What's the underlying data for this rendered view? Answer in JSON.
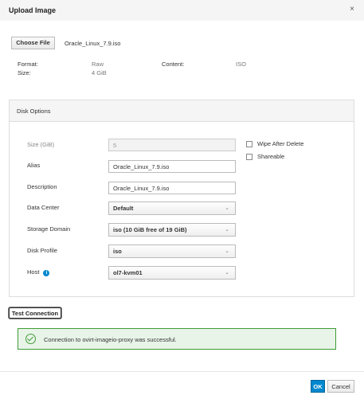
{
  "dialog": {
    "title": "Upload Image",
    "close_glyph": "×"
  },
  "file": {
    "choose_label": "Choose File",
    "name": "Oracle_Linux_7.9.iso"
  },
  "meta": {
    "format_label": "Format:",
    "format_value": "Raw",
    "content_label": "Content:",
    "content_value": "ISO",
    "size_label": "Size:",
    "size_value": "4 GiB"
  },
  "disk_options": {
    "title": "Disk Options",
    "size_label": "Size (GiB)",
    "size_value": "5",
    "alias_label": "Alias",
    "alias_value": "Oracle_Linux_7.9.iso",
    "description_label": "Description",
    "description_value": "Oracle_Linux_7.9.iso",
    "data_center_label": "Data Center",
    "data_center_value": "Default",
    "storage_domain_label": "Storage Domain",
    "storage_domain_value": "iso (10 GiB free of 19 GiB)",
    "disk_profile_label": "Disk Profile",
    "disk_profile_value": "iso",
    "host_label": "Host",
    "host_value": "ol7-kvm01",
    "wipe_label": "Wipe After Delete",
    "wipe_checked": false,
    "shareable_label": "Shareable",
    "shareable_checked": false
  },
  "connection": {
    "test_label": "Test Connection",
    "message": "Connection to ovirt-imageio-proxy was successful."
  },
  "footer": {
    "ok_label": "OK",
    "cancel_label": "Cancel"
  },
  "icons": {
    "chevron": "⌄",
    "info": "i"
  },
  "colors": {
    "primary": "#0088ce",
    "success": "#3f9c35",
    "success_bg": "#e9f4e9"
  }
}
